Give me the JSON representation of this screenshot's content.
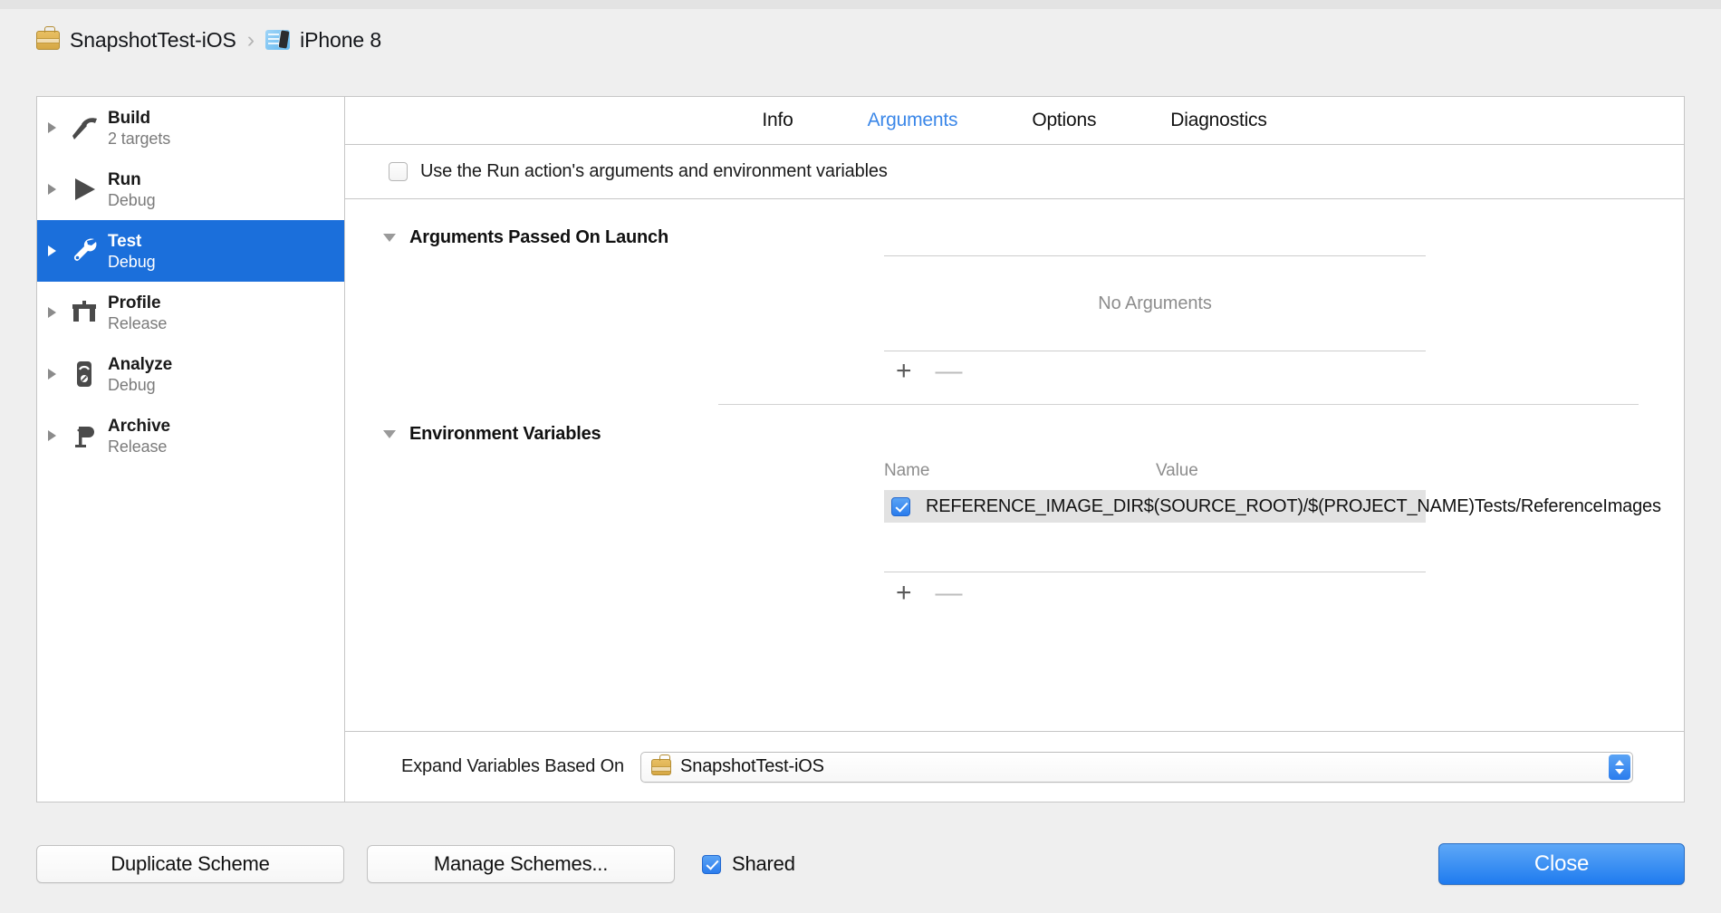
{
  "breadcrumb": {
    "scheme_icon": "briefcase-icon",
    "scheme_name": "SnapshotTest-iOS",
    "separator": "›",
    "device_icon": "simulator-device-icon",
    "device_name": "iPhone 8"
  },
  "sidebar": {
    "items": [
      {
        "name": "Build",
        "sub": "2 targets",
        "icon": "hammer-icon",
        "selected": false
      },
      {
        "name": "Run",
        "sub": "Debug",
        "icon": "play-icon",
        "selected": false
      },
      {
        "name": "Test",
        "sub": "Debug",
        "icon": "wrench-icon",
        "selected": true
      },
      {
        "name": "Profile",
        "sub": "Release",
        "icon": "caliper-icon",
        "selected": false
      },
      {
        "name": "Analyze",
        "sub": "Debug",
        "icon": "stethoscope-icon",
        "selected": false
      },
      {
        "name": "Archive",
        "sub": "Release",
        "icon": "archive-icon",
        "selected": false
      }
    ]
  },
  "tabs": [
    {
      "label": "Info",
      "active": false
    },
    {
      "label": "Arguments",
      "active": true
    },
    {
      "label": "Options",
      "active": false
    },
    {
      "label": "Diagnostics",
      "active": false
    }
  ],
  "use_run_action": {
    "label": "Use the Run action's arguments and environment variables",
    "checked": false
  },
  "arguments_section": {
    "title": "Arguments Passed On Launch",
    "expanded": true,
    "empty_message": "No Arguments",
    "add_label": "+",
    "remove_label": "—",
    "remove_enabled": false
  },
  "environment_section": {
    "title": "Environment Variables",
    "expanded": true,
    "columns": {
      "name": "Name",
      "value": "Value"
    },
    "rows": [
      {
        "checked": true,
        "name": "REFERENCE_IMAGE_DIR",
        "value": "$(SOURCE_ROOT)/$(PROJECT_NAME)Tests/ReferenceImages"
      }
    ],
    "add_label": "+",
    "remove_label": "—",
    "remove_enabled": false
  },
  "expand_variables": {
    "label": "Expand Variables Based On",
    "selected_value": "SnapshotTest-iOS",
    "icon": "briefcase-icon"
  },
  "bottom_bar": {
    "duplicate_scheme": "Duplicate Scheme",
    "manage_schemes": "Manage Schemes...",
    "shared_label": "Shared",
    "shared_checked": true,
    "close": "Close"
  },
  "colors": {
    "accent_blue": "#1b6fdb",
    "tab_active": "#3b87e8",
    "checkbox_blue": "#2a7ced",
    "row_highlight": "#e2e2e2",
    "window_bg": "#efefef"
  }
}
